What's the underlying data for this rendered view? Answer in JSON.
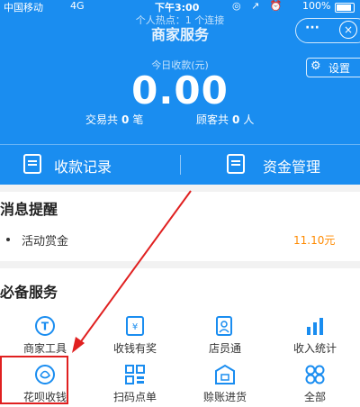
{
  "status_bar": {
    "carrier": "中国移动",
    "network": "4G",
    "time": "下午3:00",
    "battery": "100%"
  },
  "hotspot_banner": "个人热点：1 个连接",
  "nav": {
    "title": "商家服务",
    "more": "···",
    "close": "×"
  },
  "summary": {
    "today_label": "今日收款(元)",
    "amount": "0.00",
    "trade_prefix": "交易共",
    "trade_count": "0",
    "trade_unit": "笔",
    "customer_prefix": "顾客共",
    "customer_count": "0",
    "customer_unit": "人",
    "settings_label": "设置"
  },
  "tabs": {
    "records": "收款记录",
    "funds": "资金管理"
  },
  "notices": {
    "title": "消息提醒",
    "items": [
      {
        "label": "活动赏金",
        "value": "11.10元"
      }
    ]
  },
  "services": {
    "title": "必备服务",
    "items": [
      {
        "label": "商家工具",
        "icon": "merchant-tools-icon"
      },
      {
        "label": "收钱有奖",
        "icon": "reward-icon"
      },
      {
        "label": "店员通",
        "icon": "clerk-icon"
      },
      {
        "label": "收入统计",
        "icon": "stats-icon"
      },
      {
        "label": "花呗收钱",
        "icon": "huabei-icon"
      },
      {
        "label": "扫码点单",
        "icon": "scan-order-icon"
      },
      {
        "label": "赊账进货",
        "icon": "credit-purchase-icon"
      },
      {
        "label": "全部",
        "icon": "all-icon"
      }
    ]
  },
  "colors": {
    "brand_blue": "#1a8df0",
    "accent_orange": "#ff8a00",
    "highlight_red": "#e02020"
  }
}
